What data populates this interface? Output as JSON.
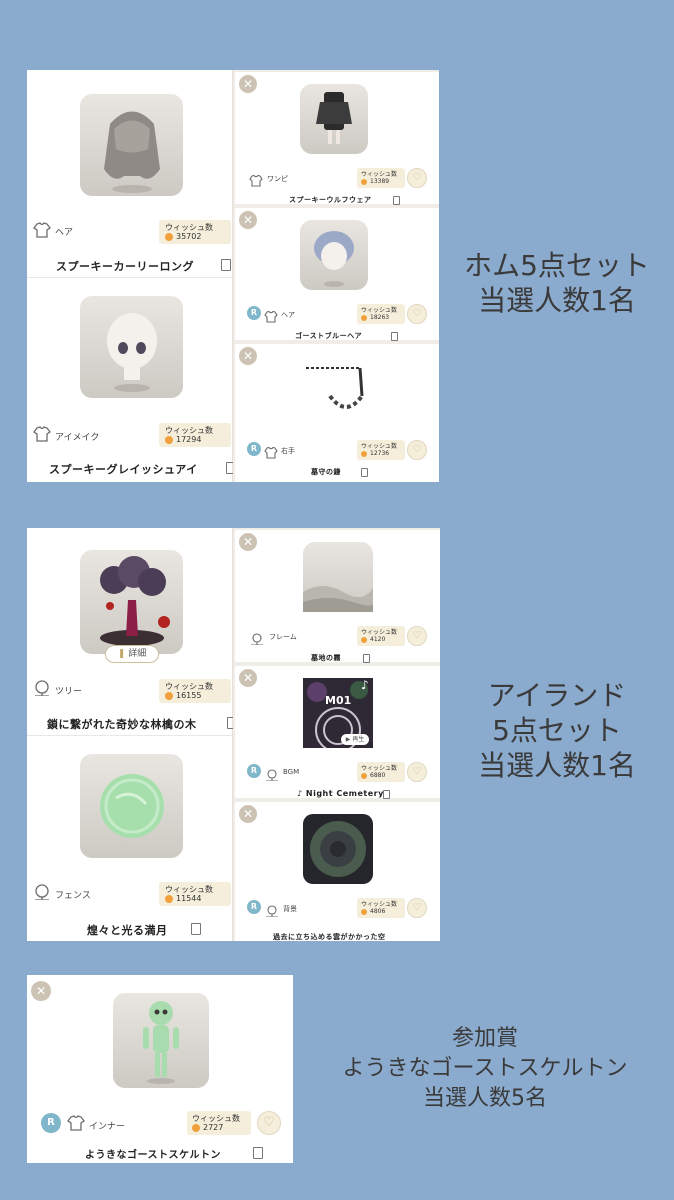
{
  "colors": {
    "background": "#8aaace",
    "wish_box": "#f4eedb",
    "heart": "#f0a13c",
    "r_badge": "#7fb6c9"
  },
  "wish_label": "ウィッシュ数",
  "set1": {
    "side_line1": "ホム5点セット",
    "side_line2": "当選人数1名",
    "left": [
      {
        "category": "ヘア",
        "wish": "35702",
        "name": "スプーキーカーリーロング"
      },
      {
        "category": "アイメイク",
        "wish": "17294",
        "name": "スプーキーグレイッシュアイ"
      }
    ],
    "right": [
      {
        "category": "ワンピ",
        "wish": "13389",
        "name": "スプーキーウルフウェア"
      },
      {
        "badge": "R",
        "category": "ヘア",
        "wish": "18263",
        "name": "ゴーストブルーヘア"
      },
      {
        "badge": "R",
        "category": "右手",
        "wish": "12736",
        "name": "墓守の鎌"
      }
    ]
  },
  "set2": {
    "side_line1": "アイランド",
    "side_line2": "5点セット",
    "side_line3": "当選人数1名",
    "detail_label": "詳細",
    "play_label": "再生",
    "bgm_code": "M01",
    "left": [
      {
        "category": "ツリー",
        "wish": "16155",
        "name": "鎖に繋がれた奇妙な林檎の木"
      },
      {
        "category": "フェンス",
        "wish": "11544",
        "name": "煌々と光る満月"
      }
    ],
    "right": [
      {
        "category": "フレーム",
        "wish": "4120",
        "name": "墓地の霧"
      },
      {
        "badge": "R",
        "category": "BGM",
        "wish": "6880",
        "name": "♪ Night Cemetery"
      },
      {
        "badge": "R",
        "category": "背景",
        "wish": "4806",
        "name": "過去に立ち込める雲がかかった空"
      }
    ]
  },
  "set3": {
    "side_line1": "参加賞",
    "side_line2": "ようきなゴーストスケルトン",
    "side_line3": "当選人数5名",
    "item": {
      "badge": "R",
      "category": "インナー",
      "wish": "2727",
      "name": "ようきなゴーストスケルトン"
    }
  }
}
